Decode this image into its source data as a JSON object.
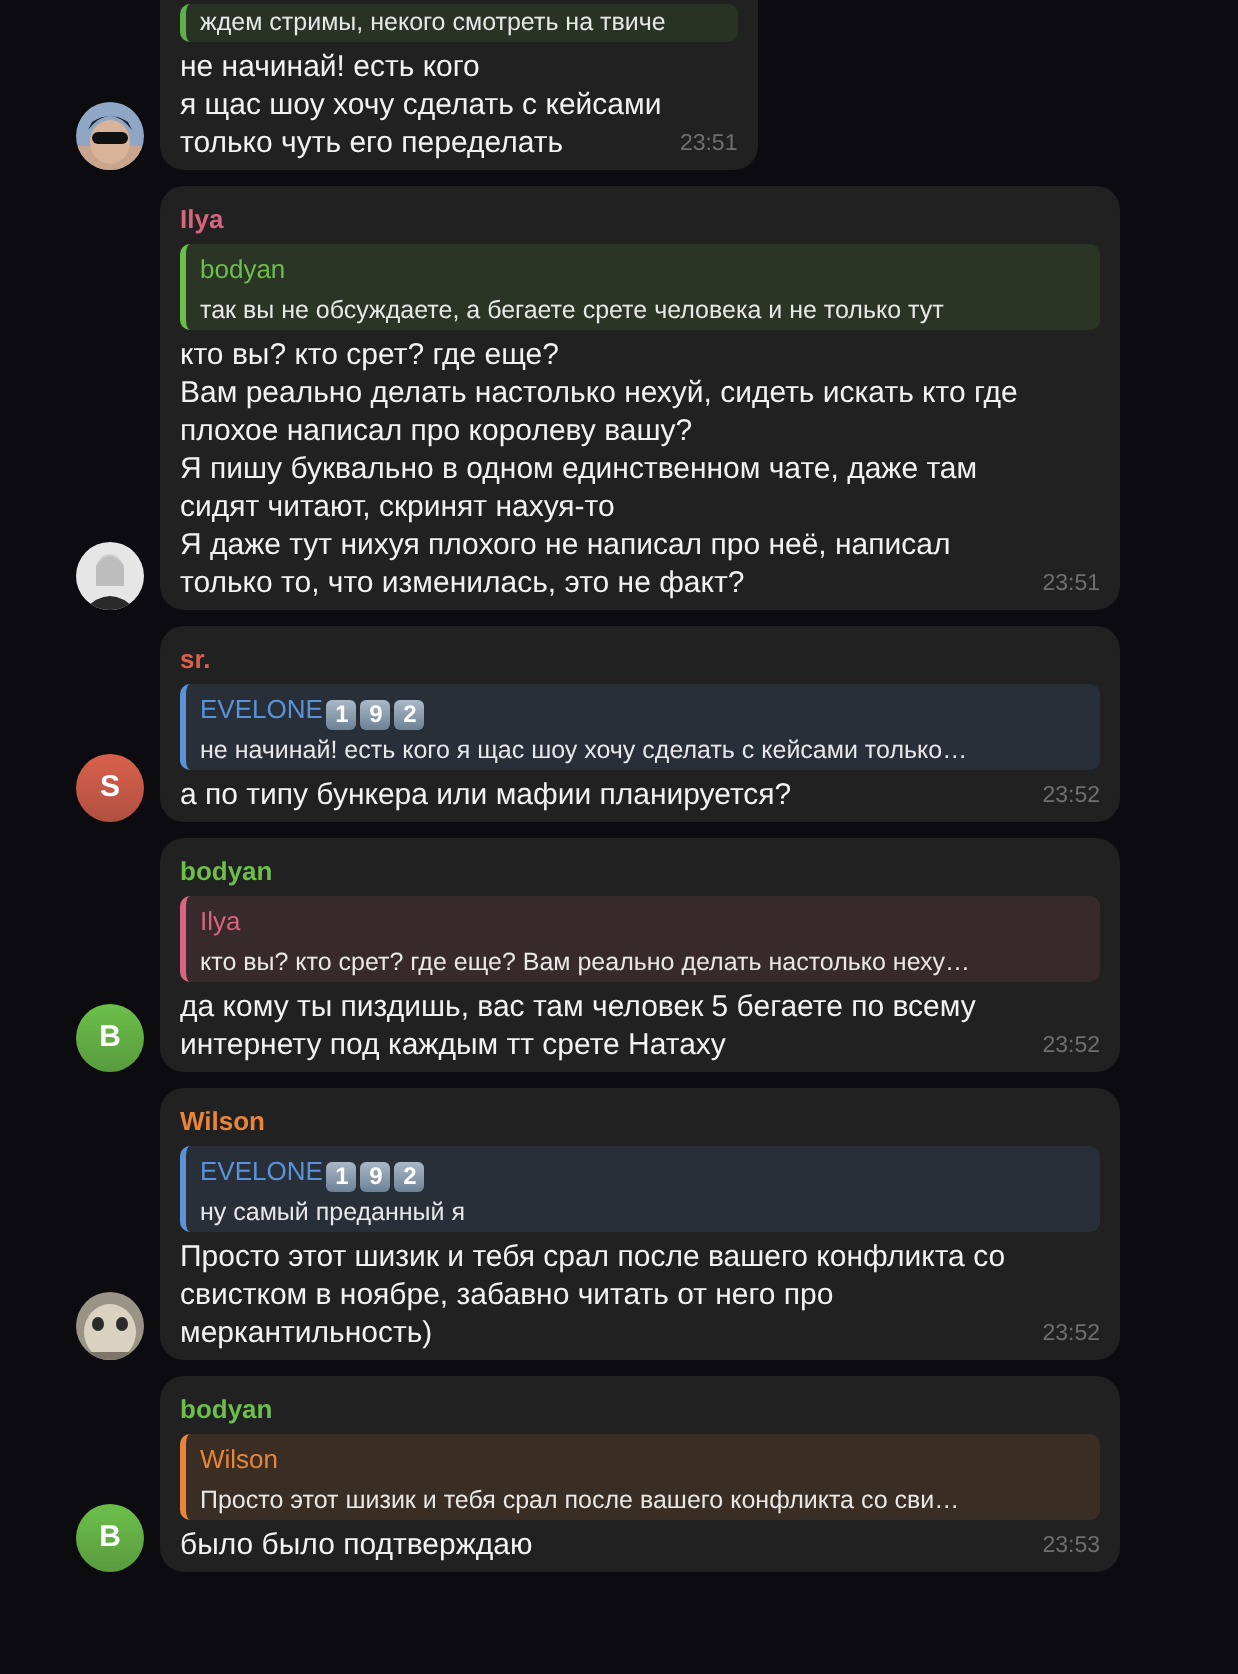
{
  "messages": [
    {
      "reply": {
        "color": "#5fb04b",
        "text": "ждем стримы, некого смотреть на твиче"
      },
      "text": "не начинай! есть кого\nя щас шоу хочу сделать с кейсами\nтолько чуть его переделать",
      "time": "23:51"
    },
    {
      "sender": "Ilya",
      "color": "#d7657e",
      "reply": {
        "author": "bodyan",
        "color": "#6cbf4a",
        "text": "так вы не обсуждаете, а бегаете срете человека и не только тут"
      },
      "text": "кто вы? кто срет? где еще?\nВам реально делать настолько нехуй, сидеть искать кто где плохое написал про королеву вашу?\nЯ пишу буквально в одном единственном чате, даже там сидят читают, скринят нахуя-то\nЯ даже тут нихуя плохого не написал про неё, написал только то, что изменилась, это не факт?",
      "time": "23:51"
    },
    {
      "sender": "sr.",
      "color": "#d9614c",
      "avatar": {
        "kind": "letter",
        "letter": "S",
        "color": "#d9614c"
      },
      "reply": {
        "author": "EVELONE",
        "color": "#5a93d8",
        "badges": [
          "1",
          "9",
          "2"
        ],
        "text": "не начинай! есть кого я щас шоу хочу сделать с кейсами только…"
      },
      "text": "а по типу бункера или мафии планируется?",
      "time": "23:52"
    },
    {
      "sender": "bodyan",
      "color": "#6cbf4a",
      "avatar": {
        "kind": "letter",
        "letter": "B",
        "color": "#6cbf4a"
      },
      "reply": {
        "author": "Ilya",
        "color": "#d7657e",
        "text": "кто вы? кто срет? где еще? Вам реально делать настолько неху…"
      },
      "text": "да кому ты пиздишь, вас там человек 5 бегаете по всему интернету под каждым тт срете Натаху",
      "time": "23:52"
    },
    {
      "sender": "Wilson",
      "color": "#e8853a",
      "reply": {
        "author": "EVELONE",
        "color": "#5a93d8",
        "badges": [
          "1",
          "9",
          "2"
        ],
        "text": "ну самый преданный я"
      },
      "text": "Просто этот шизик и тебя срал после вашего конфликта со свистком в ноябре, забавно читать от него про меркантильность)",
      "time": "23:52"
    },
    {
      "sender": "bodyan",
      "color": "#6cbf4a",
      "avatar": {
        "kind": "letter",
        "letter": "B",
        "color": "#6cbf4a"
      },
      "reply": {
        "author": "Wilson",
        "color": "#e8853a",
        "text": "Просто этот шизик и тебя срал после вашего конфликта со сви…"
      },
      "text": "было было подтверждаю",
      "time": "23:53"
    }
  ]
}
